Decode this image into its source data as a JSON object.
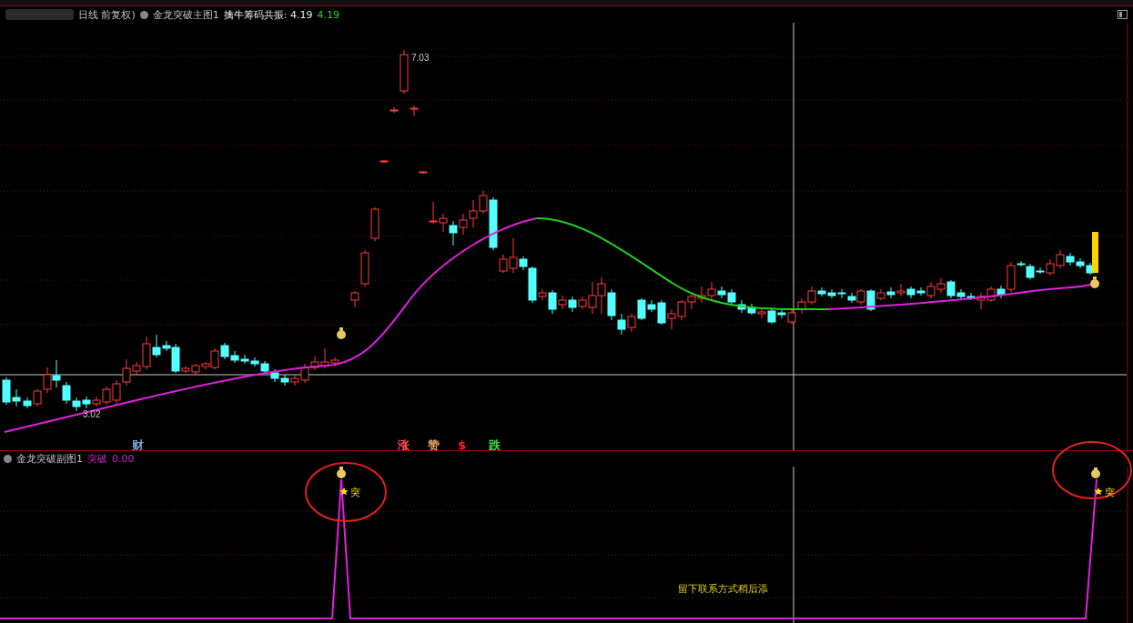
{
  "main_header": {
    "period": "日线 前复权)",
    "indicator": "金龙突破主图1",
    "line_label": "擒牛筹码共振:",
    "line_value": "4.19",
    "line_value_2": "4.19"
  },
  "main_chart": {
    "high_label": "7.03",
    "low_label": "3.02",
    "markers": [
      {
        "text": "财",
        "color": "#7aa6e0"
      },
      {
        "text": "涨",
        "color": "#ff5050"
      },
      {
        "text": "赞",
        "color": "#e0a060"
      },
      {
        "text": "$",
        "color": "#ff2020"
      },
      {
        "text": "跌",
        "color": "#40e040"
      }
    ]
  },
  "sub_header": {
    "indicator": "金龙突破副图1",
    "series_label": "突破",
    "series_value": "0.00"
  },
  "sub_chart": {
    "signals": [
      {
        "text": "突"
      },
      {
        "text": "突"
      }
    ],
    "note": "留下联系方式稍后添"
  }
}
